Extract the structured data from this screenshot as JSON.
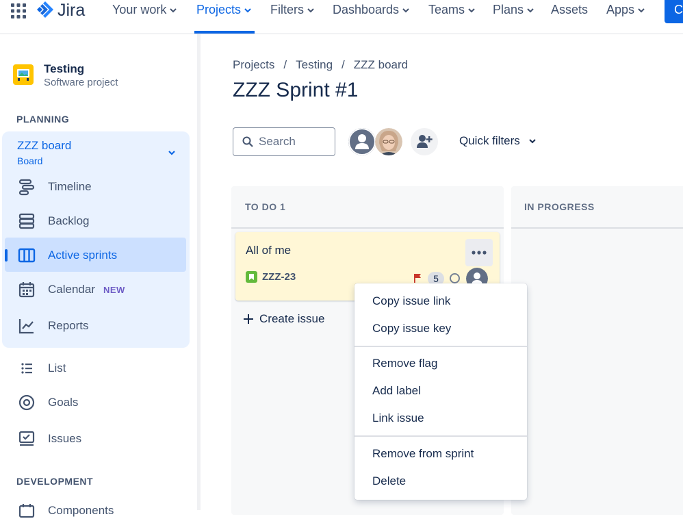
{
  "topnav": {
    "logo_text": "Jira",
    "items": [
      {
        "label": "Your work"
      },
      {
        "label": "Projects"
      },
      {
        "label": "Filters"
      },
      {
        "label": "Dashboards"
      },
      {
        "label": "Teams"
      },
      {
        "label": "Plans"
      },
      {
        "label": "Assets"
      },
      {
        "label": "Apps"
      }
    ],
    "active": "Projects",
    "create_label": "C",
    "accent": "#0c66e4"
  },
  "sidebar": {
    "project_name": "Testing",
    "project_type": "Software project",
    "planning_heading": "PLANNING",
    "board_name": "ZZZ board",
    "board_sub": "Board",
    "items": [
      {
        "label": "Timeline",
        "icon": "timeline-icon"
      },
      {
        "label": "Backlog",
        "icon": "backlog-icon"
      },
      {
        "label": "Active sprints",
        "icon": "board-icon"
      },
      {
        "label": "Calendar",
        "icon": "calendar-icon",
        "badge": "NEW"
      },
      {
        "label": "Reports",
        "icon": "reports-icon"
      }
    ],
    "extra_items": [
      {
        "label": "List",
        "icon": "list-icon"
      },
      {
        "label": "Goals",
        "icon": "goals-icon"
      },
      {
        "label": "Issues",
        "icon": "issues-icon"
      }
    ],
    "development_heading": "DEVELOPMENT",
    "partial_item": "Components"
  },
  "main": {
    "breadcrumb": [
      "Projects",
      "/",
      "Testing",
      "/",
      "ZZZ board"
    ],
    "title": "ZZZ Sprint #1",
    "search_placeholder": "Search",
    "quick_filters_label": "Quick filters",
    "columns": [
      {
        "header": "TO DO 1"
      },
      {
        "header": "IN PROGRESS"
      }
    ],
    "card": {
      "title": "All of me",
      "issue_key": "ZZZ-23",
      "story_points": "5",
      "flag_color": "#c9372c",
      "bg_color": "#fff7d6"
    },
    "create_issue_label": "Create issue"
  },
  "menu": {
    "items": [
      "Copy issue link",
      "Copy issue key",
      "Remove flag",
      "Add label",
      "Link issue",
      "Remove from sprint",
      "Delete"
    ]
  }
}
